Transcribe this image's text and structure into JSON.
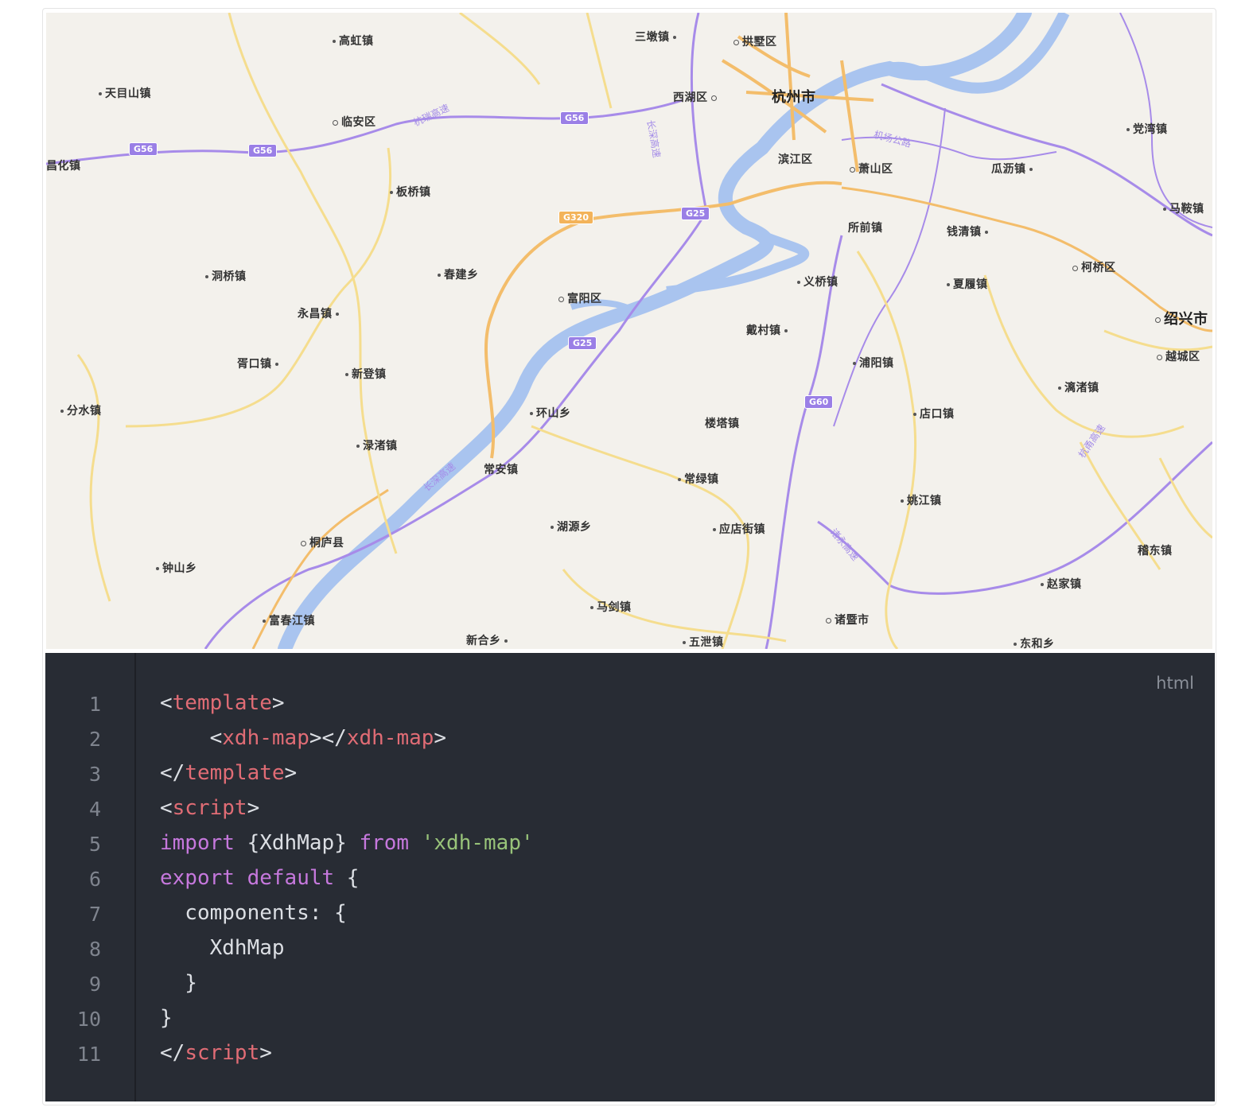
{
  "map": {
    "labels": {
      "hangzhou": "杭州市",
      "gongshu": "拱墅区",
      "xihu": "西湖区",
      "binjiang": "滨江区",
      "xiaoshan": "萧山区",
      "linan": "临安区",
      "fuyang": "富阳区",
      "tonglu": "桐庐县",
      "kecheng": "柯桥区",
      "shaoxing": "绍兴市",
      "yuecheng": "越城区",
      "zhuji": "诸暨市",
      "gaohong": "高虹镇",
      "tianmushan": "天目山镇",
      "changhua": "昌化镇",
      "banqiao": "板桥镇",
      "sandun": "三墩镇",
      "dangwan": "党湾镇",
      "guali": "瓜沥镇",
      "maan": "马鞍镇",
      "suoqian": "所前镇",
      "qianqing": "钱清镇",
      "yiqiao": "义桥镇",
      "xiaying": "夏履镇",
      "chunjian": "春建乡",
      "dongqiao": "洞桥镇",
      "yongchang": "永昌镇",
      "daicun": "戴村镇",
      "puyang": "浦阳镇",
      "xukou": "胥口镇",
      "xindeng": "新登镇",
      "lizhu": "漓渚镇",
      "fenshui": "分水镇",
      "huanshan": "环山乡",
      "louta": "楼塔镇",
      "diankou": "店口镇",
      "luzhu": "渌渚镇",
      "changan": "常安镇",
      "changlv": "常绿镇",
      "yaojiang": "姚江镇",
      "huyuan": "湖源乡",
      "yingdianjie": "应店街镇",
      "jidong": "稽东镇",
      "zhongshan": "钟山乡",
      "zhaojia": "赵家镇",
      "majian": "马剑镇",
      "fuchunjiang": "富春江镇",
      "xinhe": "新合乡",
      "wuxie": "五泄镇",
      "donghe": "东和乡"
    },
    "shields": {
      "g56a": "G56",
      "g56b": "G56",
      "g56c": "G56",
      "g25a": "G25",
      "g25b": "G25",
      "g320": "G320",
      "g60": "G60"
    },
    "highway_names": {
      "hangrui": "杭瑞高速",
      "changshen_a": "长深高速",
      "changshen_b": "长深高速",
      "jichang": "机场公路",
      "zhuyong": "诸永高速",
      "hangshaotai": "杭甬高速"
    },
    "colors": {
      "background": "#f3f1ec",
      "river": "#a9c4ef",
      "expressway": "#a78be9",
      "national_road": "#f3bd6b",
      "provincial_road": "#f5dd8e"
    }
  },
  "code": {
    "language": "html",
    "line_numbers": [
      "1",
      "2",
      "3",
      "4",
      "5",
      "6",
      "7",
      "8",
      "9",
      "10",
      "11"
    ],
    "l1": {
      "open": "<",
      "tag": "template",
      "close": ">"
    },
    "l2": {
      "indent": "    ",
      "open": "<",
      "tag": "xdh-map",
      "mid": "></",
      "tag2": "xdh-map",
      "close": ">"
    },
    "l3": {
      "open": "</",
      "tag": "template",
      "close": ">"
    },
    "l4": {
      "open": "<",
      "tag": "script",
      "close": ">"
    },
    "l5": {
      "kw": "import",
      "mid": " {XdhMap} ",
      "kw2": "from",
      "sp": " ",
      "str": "'xdh-map'"
    },
    "l6": {
      "kw": "export",
      "sp": " ",
      "kw2": "default",
      "rest": " {"
    },
    "l7": {
      "text": "  components: {"
    },
    "l8": {
      "text": "    XdhMap"
    },
    "l9": {
      "text": "  }"
    },
    "l10": {
      "text": "}"
    },
    "l11": {
      "open": "</",
      "tag": "script",
      "close": ">"
    }
  }
}
